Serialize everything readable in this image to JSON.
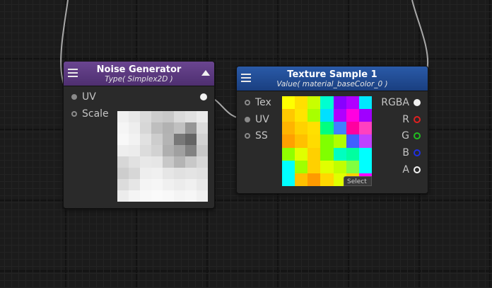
{
  "noise_node": {
    "title": "Noise Generator",
    "subtitle": "Type( Simplex2D )",
    "header_color": "#5a3a7c",
    "inputs": [
      "UV",
      "Scale"
    ],
    "preview_grays": [
      [
        240,
        232,
        218,
        205,
        200,
        218,
        225,
        235
      ],
      [
        245,
        238,
        215,
        190,
        178,
        192,
        150,
        220
      ],
      [
        248,
        242,
        225,
        205,
        180,
        120,
        100,
        210
      ],
      [
        238,
        236,
        220,
        210,
        175,
        160,
        130,
        200
      ],
      [
        215,
        225,
        232,
        230,
        200,
        180,
        200,
        215
      ],
      [
        205,
        215,
        238,
        240,
        230,
        225,
        228,
        225
      ],
      [
        220,
        230,
        244,
        246,
        240,
        236,
        240,
        232
      ],
      [
        236,
        244,
        248,
        250,
        248,
        244,
        246,
        240
      ]
    ]
  },
  "texture_node": {
    "title": "Texture Sample 1",
    "subtitle": "Value( material_baseColor_0 )",
    "header_color": "#1e4b8f",
    "inputs": [
      "Tex",
      "UV",
      "SS"
    ],
    "outputs": [
      {
        "label": "RGBA",
        "color": "#f2f2f2",
        "style": "filled"
      },
      {
        "label": "R",
        "color": "#e02020",
        "style": "ring"
      },
      {
        "label": "G",
        "color": "#20c020",
        "style": "ring"
      },
      {
        "label": "B",
        "color": "#2030e0",
        "style": "ring"
      },
      {
        "label": "A",
        "color": "#f2f2f2",
        "style": "ring"
      }
    ],
    "select_label": "Select",
    "preview_colors": [
      [
        "#ffff00",
        "#ffe000",
        "#c8ff00",
        "#00ffd0",
        "#8800ff",
        "#b000ff",
        "#00e8ff"
      ],
      [
        "#ffc800",
        "#ffe400",
        "#a8ff00",
        "#00e0ff",
        "#b000ff",
        "#ff00e0",
        "#a000ff"
      ],
      [
        "#ffb400",
        "#ffd200",
        "#ffe000",
        "#00ff80",
        "#4080ff",
        "#ff00a0",
        "#ff40c0"
      ],
      [
        "#ffa000",
        "#ffc000",
        "#ffdc00",
        "#80ff00",
        "#b0ff00",
        "#4060ff",
        "#c040ff"
      ],
      [
        "#90ff00",
        "#e0ff00",
        "#ffd000",
        "#80ff00",
        "#00ffc0",
        "#00ffa0",
        "#00ffff"
      ],
      [
        "#00ffff",
        "#a0ff00",
        "#ffd000",
        "#e0ff00",
        "#c0ff00",
        "#80ff40",
        "#00ffff"
      ],
      [
        "#00ffff",
        "#ffc000",
        "#ff9a00",
        "#ffd800",
        "#e0ff00",
        "#ffd000",
        "#ff00ff"
      ]
    ]
  }
}
